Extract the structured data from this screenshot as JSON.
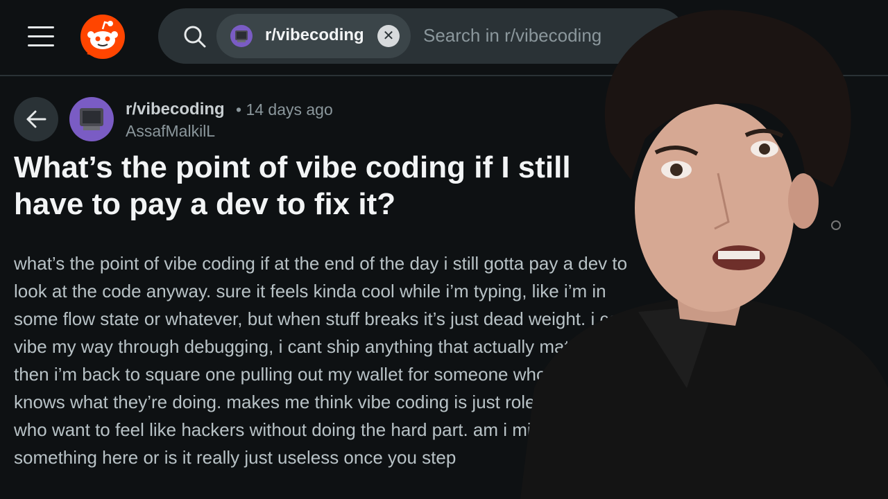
{
  "header": {
    "search_chip_label": "r/vibecoding",
    "search_placeholder": "Search in r/vibecoding"
  },
  "post": {
    "subreddit": "r/vibecoding",
    "meta": "• 14 days ago",
    "author": "AssafMalkilL",
    "title": "What’s the point of vibe coding if I still have to pay a dev to fix it?",
    "body": "what’s the point of vibe coding if at the end of the day i still gotta pay a dev to look at the code anyway. sure it feels kinda cool while i’m typing, like i’m in some flow state or whatever, but when stuff breaks it’s just dead weight. i cant vibe my way through debugging, i cant ship anything that actually matters, and then i’m back to square one pulling out my wallet for someone who actually knows what they’re doing. makes me think vibe coding is just roleplay for guys who want to feel like hackers without doing the hard part. am i missing something here or is it really just useless once you step"
  },
  "icons": [
    "menu-icon",
    "reddit-logo-icon",
    "search-icon",
    "close-icon",
    "back-arrow-icon"
  ],
  "colors": {
    "background": "#0e1113",
    "reddit_orange": "#ff4500",
    "chip": "#3b4549",
    "searchbar": "#2a3236"
  }
}
